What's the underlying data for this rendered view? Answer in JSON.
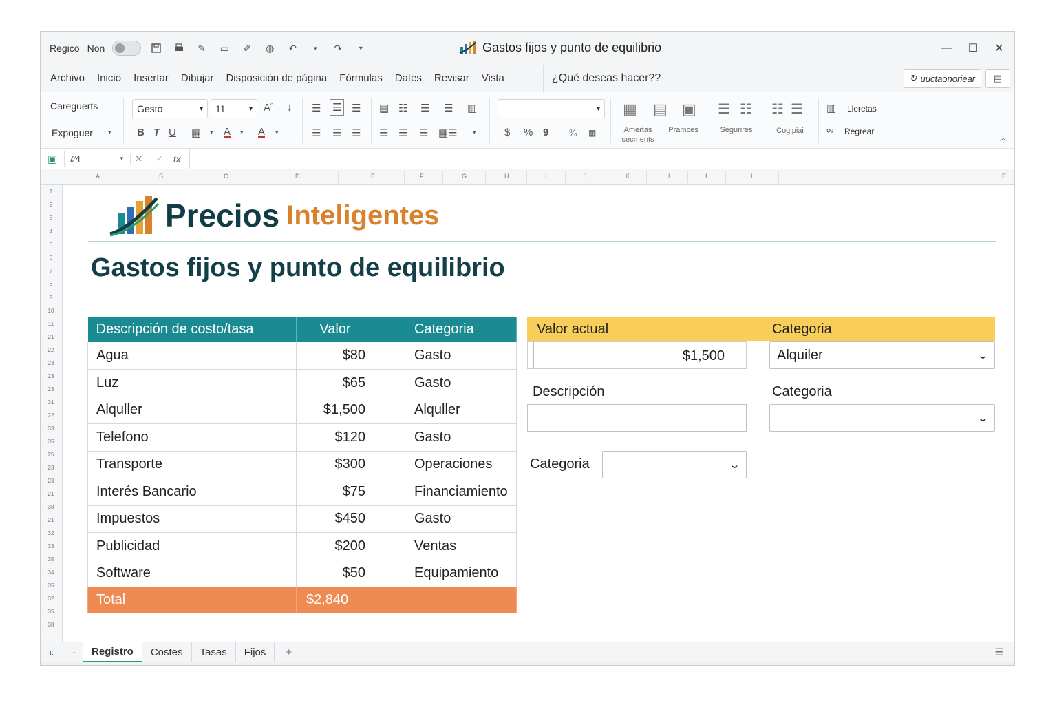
{
  "titlebar": {
    "autosave_label": "Regico",
    "autosave_state": "Non",
    "window_title": "Gastos fijos y punto de equilibrio",
    "minimize": "—",
    "maximize": "☐",
    "close": "✕"
  },
  "menu": {
    "items": [
      "Archivo",
      "Inicio",
      "Insertar",
      "Dibujar",
      "Disposición de página",
      "Fórmulas",
      "Dates",
      "Revisar",
      "Vista"
    ],
    "search_hint": "¿Qué deseas hacer??",
    "share_label": "uuctaonoriear"
  },
  "ribbon": {
    "clipboard_top": "Careguerts",
    "clipboard_bottom": "Expoguer",
    "font_name": "Gesto",
    "font_size": "11",
    "number_format": "",
    "currency": "$",
    "percent": "%",
    "comma": "9",
    "group_labels": {
      "amertas": "Amertas",
      "secments": "secments",
      "pramces": "Pramces",
      "segurires": "Segurires",
      "cogipiai": "Cogipiai",
      "lleretas": "Lleretas",
      "regrear": "Regrear"
    }
  },
  "formula_bar": {
    "cell_ref": "7⁄4",
    "formula": ""
  },
  "columns": [
    "A",
    "S",
    "C",
    "D",
    "E",
    "F",
    "G",
    "H",
    "I",
    "J",
    "K",
    "L",
    "I",
    "I",
    "E"
  ],
  "rows": [
    "1",
    "2",
    "3",
    "4",
    "6",
    "6",
    "7",
    "8",
    "9",
    "10",
    "11",
    "21",
    "22",
    "23",
    "23",
    "23",
    "31",
    "22",
    "33",
    "35",
    "25",
    "23",
    "23",
    "21",
    "38",
    "21",
    "32",
    "33",
    "35",
    "34",
    "35",
    "32",
    "35",
    "38"
  ],
  "logo": {
    "part1": "Precios",
    "part2": "Inteligentes"
  },
  "heading": "Gastos fijos y punto de equilibrio",
  "table": {
    "headers": [
      "Descripción de costo/tasa",
      "Valor",
      "Categoria"
    ],
    "rows": [
      [
        "Agua",
        "$80",
        "Gasto"
      ],
      [
        "Luz",
        "$65",
        "Gasto"
      ],
      [
        "Alquller",
        "$1,500",
        "Alquller"
      ],
      [
        "Telefono",
        "$120",
        "Gasto"
      ],
      [
        "Transporte",
        "$300",
        "Operaciones"
      ],
      [
        "Interés Bancario",
        "$75",
        "Financiamiento"
      ],
      [
        "Impuestos",
        "$450",
        "Gasto"
      ],
      [
        "Publicidad",
        "$200",
        "Ventas"
      ],
      [
        "Software",
        "$50",
        "Equipamiento"
      ]
    ],
    "total_label": "Total",
    "total_value": "$2,840"
  },
  "panel": {
    "valor_actual_label": "Valor actual",
    "categoria_label": "Categoria",
    "valor_actual": "$1,500",
    "categoria_selected": "Alquiler",
    "descripcion_label": "Descripción",
    "categoria2_label": "Categoria",
    "categoria3_label": "Categoria"
  },
  "sheets": {
    "tabs": [
      "Registro",
      "Costes",
      "Tasas",
      "Fijos"
    ],
    "active": "Registro",
    "add": "+"
  },
  "colors": {
    "table_header": "#1b8b92",
    "total_row": "#ef8a52",
    "panel_header": "#f9cd5a",
    "logo_dark": "#123c46",
    "logo_orange": "#d9822b"
  }
}
